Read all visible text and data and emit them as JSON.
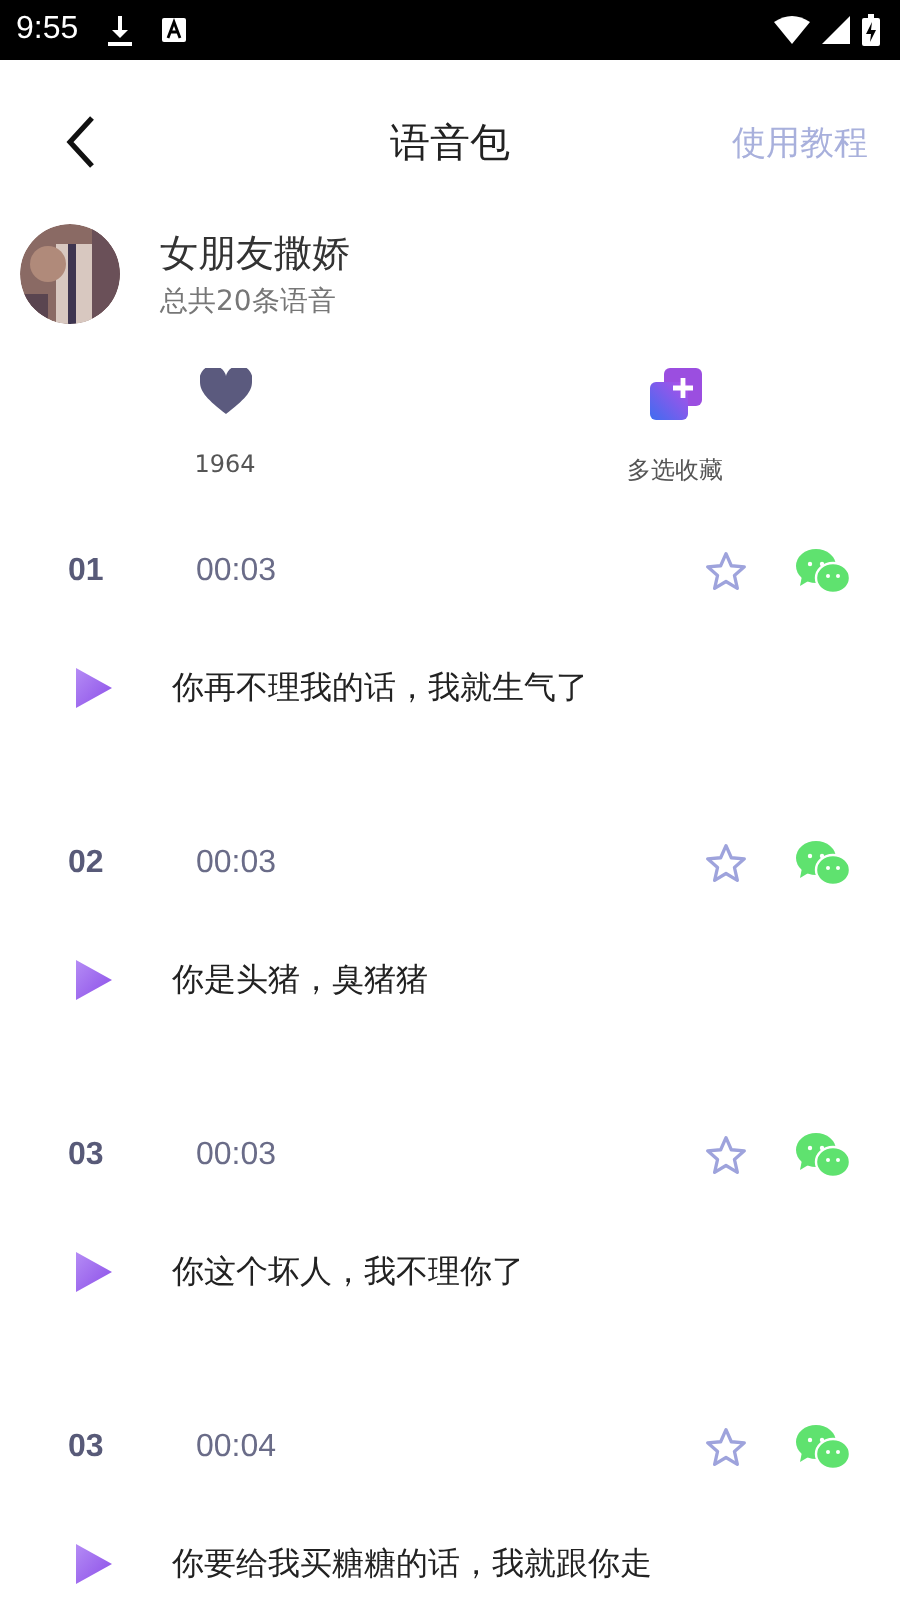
{
  "status_bar": {
    "time": "9:55"
  },
  "header": {
    "title": "语音包",
    "action": "使用教程"
  },
  "pack": {
    "name": "女朋友撒娇",
    "count": "总共20条语音"
  },
  "actions": [
    {
      "kind": "like",
      "label": "1964"
    },
    {
      "kind": "multi",
      "label": "多选收藏"
    }
  ],
  "clips": [
    {
      "number": "01",
      "duration": "00:03",
      "favorited": false,
      "text": "你再不理我的话，我就生气了"
    },
    {
      "number": "02",
      "duration": "00:03",
      "favorited": false,
      "text": "你是头猪，臭猪猪"
    },
    {
      "number": "03",
      "duration": "00:03",
      "favorited": false,
      "text": "你这个坏人，我不理你了"
    },
    {
      "number": "03",
      "duration": "00:04",
      "favorited": false,
      "text": "你要给我买糖糖的话，我就跟你走"
    }
  ]
}
